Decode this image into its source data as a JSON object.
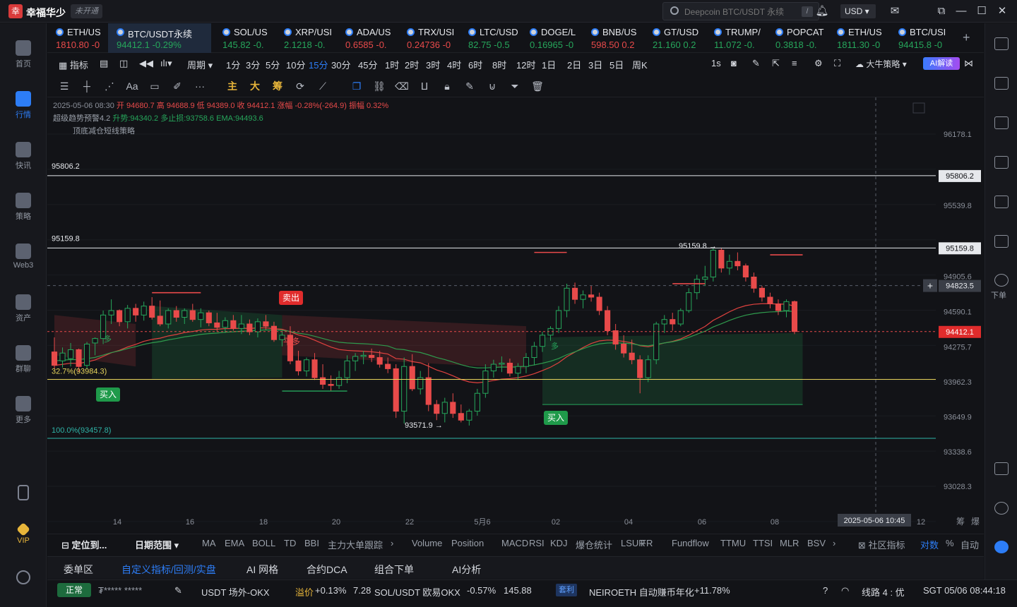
{
  "titlebar": {
    "brand": "幸福华少",
    "verify": "未开通",
    "search_placeholder": "Deepcoin BTC/USDT 永续",
    "search_key": "/",
    "currency": "USD"
  },
  "sidebar": {
    "items": [
      {
        "label": "首页",
        "icon": "home-icon"
      },
      {
        "label": "行情",
        "icon": "market-chart-icon"
      },
      {
        "label": "快讯",
        "icon": "news-icon"
      },
      {
        "label": "策略",
        "icon": "strategy-robot-icon"
      },
      {
        "label": "Web3",
        "icon": "web3-icon"
      },
      {
        "label": "资产",
        "icon": "wallet-icon"
      },
      {
        "label": "群聊",
        "icon": "chat-icon"
      },
      {
        "label": "更多",
        "icon": "more-grid-icon"
      },
      {
        "label": "",
        "icon": "phone-icon"
      },
      {
        "label": "VIP",
        "icon": "vip-diamond-icon"
      },
      {
        "label": "",
        "icon": "settings-icon"
      }
    ]
  },
  "tickers": [
    {
      "sym": "ETH/US",
      "val": "1810.80 -0",
      "dir": "down"
    },
    {
      "sym": "BTC/USDT永续",
      "val": "94412.1 -0.29%",
      "dir": "up"
    },
    {
      "sym": "SOL/US",
      "val": "145.82 -0.",
      "dir": "up"
    },
    {
      "sym": "XRP/USI",
      "val": "2.1218 -0.",
      "dir": "up"
    },
    {
      "sym": "ADA/US",
      "val": "0.6585 -0.",
      "dir": "down"
    },
    {
      "sym": "TRX/USI",
      "val": "0.24736 -0",
      "dir": "down"
    },
    {
      "sym": "LTC/USD",
      "val": "82.75 -0.5",
      "dir": "up"
    },
    {
      "sym": "DOGE/L",
      "val": "0.16965 -0",
      "dir": "up"
    },
    {
      "sym": "BNB/US",
      "val": "598.50 0.2",
      "dir": "down"
    },
    {
      "sym": "GT/USD",
      "val": "21.160 0.2",
      "dir": "up"
    },
    {
      "sym": "TRUMP/",
      "val": "11.072 -0.",
      "dir": "up"
    },
    {
      "sym": "POPCAT",
      "val": "0.3818 -0.",
      "dir": "up"
    },
    {
      "sym": "ETH/US",
      "val": "1811.30 -0",
      "dir": "up"
    },
    {
      "sym": "BTC/USI",
      "val": "94415.8 -0",
      "dir": "up"
    }
  ],
  "periodbar": {
    "indicator": "指标",
    "period": "周期",
    "periods": [
      "1分",
      "3分",
      "5分",
      "10分",
      "15分",
      "30分",
      "45分",
      "1时",
      "2时",
      "3时",
      "4时",
      "6时",
      "8时",
      "12时",
      "1日",
      "2日",
      "3日",
      "5日",
      "周K"
    ],
    "selected": "15分",
    "rate": "1s",
    "strategy": "大牛策略",
    "ai": "AI解读"
  },
  "drawbar": {
    "main": "主",
    "big": "大",
    "chip": "筹"
  },
  "chart_info": {
    "line1_date": "2025-05-06 08:30",
    "line1_ohlc": "开 94680.7  高 94688.9  低 94389.0  收 94412.1",
    "line1_change": "涨幅 -0.28%(-264.9)",
    "line1_amp": "振幅 0.32%",
    "line2_name": "超级趋势预警4.2",
    "line2_vals": "升势:94340.2  多止损:93758.6  EMA:94493.6",
    "line3": "顶底减仓短线策略"
  },
  "chart_data": {
    "type": "candlestick",
    "price_ticks": [
      "96178.1",
      "95806.2",
      "95539.8",
      "95159.8",
      "94905.6",
      "94823.5",
      "94590.1",
      "94412.1",
      "94275.7",
      "93962.3",
      "93649.9",
      "93338.6",
      "93028.3"
    ],
    "last_price": "94412.1",
    "hlines": [
      {
        "label": "95806.2",
        "value": 95806.2
      },
      {
        "label": "95159.8",
        "value": 95159.8
      },
      {
        "label": "32.7%(93984.3)",
        "value": 93984.3
      },
      {
        "label": "100.0%(93457.8)",
        "value": 93457.8
      }
    ],
    "crosshair_price": "94823.5",
    "annotations": {
      "sell": "卖出",
      "buy1": "买入",
      "buy2": "买入",
      "low": "93571.9 →",
      "high": "95159.8 →",
      "flat": "平多",
      "long": "多"
    },
    "x_ticks": [
      "14",
      "16",
      "18",
      "20",
      "22",
      "5月6",
      "02",
      "04",
      "06",
      "08",
      "2025-05-06 10:45",
      "12"
    ],
    "candles": [
      [
        94230,
        94360,
        94080,
        94110
      ],
      [
        94150,
        94270,
        94090,
        94220
      ],
      [
        94170,
        94310,
        94100,
        94250
      ],
      [
        94250,
        94260,
        94050,
        94100
      ],
      [
        94110,
        94320,
        94080,
        94300
      ],
      [
        94310,
        94360,
        94200,
        94350
      ],
      [
        94350,
        94600,
        94300,
        94560
      ],
      [
        94560,
        94700,
        94480,
        94600
      ],
      [
        94600,
        94610,
        94460,
        94500
      ],
      [
        94500,
        94650,
        94440,
        94620
      ],
      [
        94620,
        94660,
        94500,
        94560
      ],
      [
        94560,
        94680,
        94510,
        94640
      ],
      [
        94640,
        94720,
        94520,
        94540
      ],
      [
        94550,
        94690,
        94460,
        94480
      ],
      [
        94480,
        94620,
        94440,
        94600
      ],
      [
        94600,
        94640,
        94500,
        94540
      ],
      [
        94540,
        94620,
        94480,
        94600
      ],
      [
        94600,
        94660,
        94500,
        94520
      ],
      [
        94520,
        94620,
        94450,
        94580
      ],
      [
        94580,
        94600,
        94460,
        94490
      ],
      [
        94490,
        94580,
        94410,
        94450
      ],
      [
        94450,
        94540,
        94400,
        94510
      ],
      [
        94510,
        94560,
        94420,
        94440
      ],
      [
        94440,
        94560,
        94390,
        94480
      ],
      [
        94480,
        94520,
        94380,
        94410
      ],
      [
        94410,
        94530,
        94360,
        94500
      ],
      [
        94500,
        94560,
        94430,
        94460
      ],
      [
        94460,
        94500,
        94320,
        94340
      ],
      [
        94340,
        94420,
        94280,
        94380
      ],
      [
        94380,
        94460,
        94120,
        94150
      ],
      [
        94150,
        94240,
        94020,
        94060
      ],
      [
        94060,
        94180,
        94010,
        94160
      ],
      [
        94160,
        94220,
        93980,
        94000
      ],
      [
        94000,
        94120,
        93900,
        93940
      ],
      [
        93940,
        94020,
        93880,
        93930
      ],
      [
        93930,
        94060,
        93900,
        94000
      ],
      [
        94000,
        94200,
        93950,
        94150
      ],
      [
        94150,
        94220,
        94060,
        94190
      ],
      [
        94190,
        94240,
        94120,
        94200
      ],
      [
        94200,
        94260,
        94140,
        94180
      ],
      [
        94180,
        94240,
        94090,
        94120
      ],
      [
        94120,
        94180,
        94040,
        94080
      ],
      [
        94080,
        94120,
        93640,
        93700
      ],
      [
        93700,
        94180,
        93590,
        94100
      ],
      [
        94100,
        94210,
        93880,
        93900
      ],
      [
        93900,
        94060,
        93850,
        94000
      ],
      [
        94000,
        94130,
        93700,
        93760
      ],
      [
        93760,
        93800,
        93620,
        93680
      ],
      [
        93680,
        93820,
        93600,
        93780
      ],
      [
        93780,
        93860,
        93640,
        93680
      ],
      [
        93680,
        93760,
        93600,
        93620
      ],
      [
        93620,
        93720,
        93571.9,
        93700
      ],
      [
        93700,
        93900,
        93660,
        93860
      ],
      [
        93860,
        94120,
        93820,
        94060
      ],
      [
        94060,
        94160,
        94000,
        94120
      ],
      [
        94120,
        94190,
        94050,
        94130
      ],
      [
        94130,
        94170,
        94010,
        94040
      ],
      [
        94040,
        94130,
        93980,
        94100
      ],
      [
        94100,
        94220,
        94040,
        94180
      ],
      [
        94180,
        94320,
        94110,
        94280
      ],
      [
        94280,
        94410,
        94230,
        94380
      ],
      [
        94380,
        94460,
        94330,
        94440
      ],
      [
        94440,
        94640,
        94400,
        94600
      ],
      [
        94600,
        94840,
        94540,
        94800
      ],
      [
        94800,
        94850,
        94660,
        94700
      ],
      [
        94700,
        94780,
        94620,
        94740
      ],
      [
        94740,
        94820,
        94680,
        94720
      ],
      [
        94720,
        94760,
        94560,
        94600
      ],
      [
        94600,
        94640,
        94380,
        94420
      ],
      [
        94420,
        94480,
        94250,
        94300
      ],
      [
        94300,
        94380,
        94180,
        94220
      ],
      [
        94220,
        94340,
        94120,
        94160
      ],
      [
        94160,
        94200,
        93860,
        94000
      ],
      [
        94000,
        94200,
        93960,
        94160
      ],
      [
        94160,
        94500,
        94120,
        94480
      ],
      [
        94480,
        94560,
        94400,
        94520
      ],
      [
        94520,
        94580,
        94420,
        94480
      ],
      [
        94480,
        94620,
        94460,
        94600
      ],
      [
        94600,
        94800,
        94580,
        94760
      ],
      [
        94760,
        94920,
        94700,
        94880
      ],
      [
        94880,
        95000,
        94820,
        94900
      ],
      [
        94900,
        95160,
        94860,
        95140
      ],
      [
        95140,
        95159.8,
        94940,
        94980
      ],
      [
        94980,
        95100,
        94920,
        95040
      ],
      [
        95040,
        95120,
        94960,
        95000
      ],
      [
        95000,
        95020,
        94860,
        94900
      ],
      [
        94900,
        94940,
        94760,
        94800
      ],
      [
        94800,
        94820,
        94680,
        94720
      ],
      [
        94720,
        94760,
        94620,
        94660
      ],
      [
        94660,
        94700,
        94560,
        94600
      ],
      [
        94600,
        94700,
        94540,
        94680
      ],
      [
        94680,
        94688.9,
        94389,
        94412.1
      ]
    ]
  },
  "indbar": {
    "locate": "定位到...",
    "range": "日期范围",
    "main_inds": [
      "MA",
      "EMA",
      "BOLL",
      "TD",
      "BBI",
      "主力大单跟踪"
    ],
    "sub_inds": [
      "Volume",
      "Position",
      "MACD",
      "RSI",
      "KDJ",
      "爆仓统计",
      "LSUR",
      "FR",
      "Fundflow",
      "TTMU",
      "TTSI",
      "MLR",
      "BSV"
    ],
    "community": "社区指标",
    "log": "对数",
    "pct": "%",
    "auto": "自动"
  },
  "bottom_tabs": [
    "委单区",
    "自定义指标/回测/实盘",
    "AI 网格",
    "合约DCA",
    "组合下单",
    "AI分析"
  ],
  "status": {
    "state": "正常",
    "user": "₮*****  *****",
    "usdt_label": "USDT 场外-OKX",
    "usdt_prem_label": "溢价",
    "usdt_prem": "+0.13%",
    "usdt_price": "7.28",
    "sol_label": "SOL/USDT 欧易OKX",
    "sol_chg": "-0.57%",
    "sol_price": "145.88",
    "arb": "套利",
    "neiro": "NEIROETH 自动赚币年化",
    "neiro_val": "+11.78%",
    "line": "线路 4 : 优",
    "time": "SGT 05/06 08:44:18"
  },
  "colors": {
    "up": "#26a65b",
    "down": "#e84a4a",
    "accent": "#2d7df6",
    "bg": "#121317"
  }
}
